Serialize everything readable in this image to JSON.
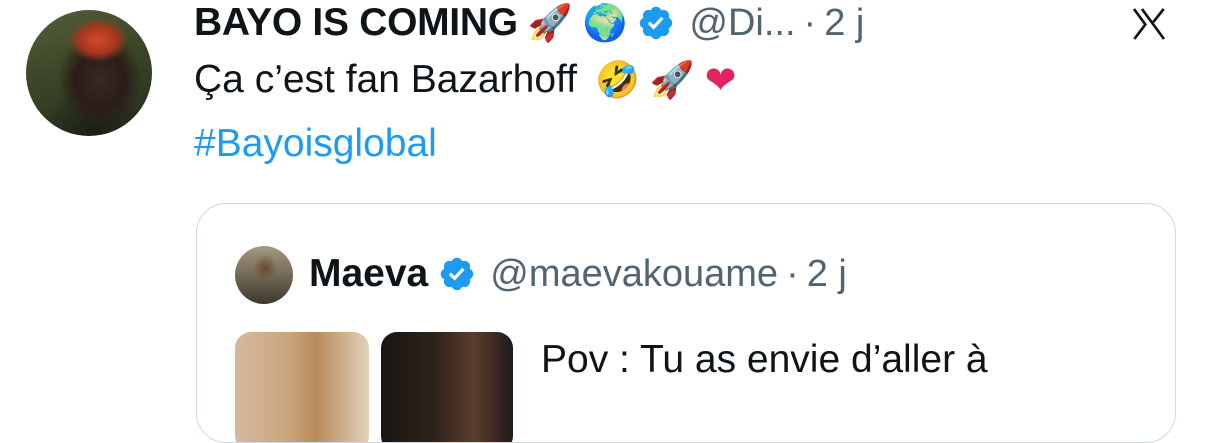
{
  "tweet": {
    "author_name": "BAYO IS COMING",
    "emojis": [
      "🚀",
      "🌍"
    ],
    "handle": "@Di...",
    "separator": "·",
    "time": "2 j",
    "text": "Ça c’est fan Bazarhoff",
    "text_emojis": [
      "🤣",
      "🚀"
    ],
    "heart": "❤",
    "hashtag": "#Bayoisglobal"
  },
  "quoted": {
    "author_name": "Maeva",
    "handle": "@maevakouame",
    "separator": "·",
    "time": "2 j",
    "text": "Pov : Tu as envie d’aller à"
  },
  "colors": {
    "verified_blue": "#1d9bf0",
    "handle_gray": "#536471",
    "heart_red": "#e0245e"
  },
  "icons": [
    "verified-badge-icon",
    "x-logo-icon",
    "heart-icon"
  ]
}
